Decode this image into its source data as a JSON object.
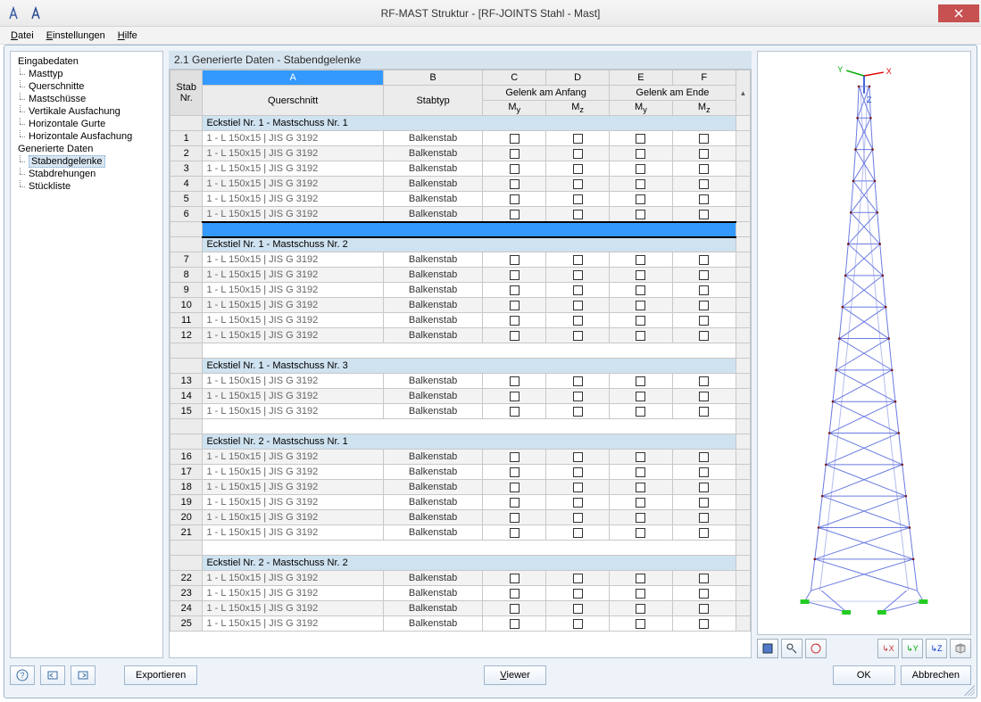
{
  "title": "RF-MAST Struktur - [RF-JOINTS Stahl - Mast]",
  "menu": {
    "file": "Datei",
    "settings": "Einstellungen",
    "help": "Hilfe"
  },
  "tree": {
    "g1": "Eingabedaten",
    "g1_items": [
      "Masttyp",
      "Querschnitte",
      "Mastschüsse",
      "Vertikale Ausfachung",
      "Horizontale Gurte",
      "Horizontale Ausfachung"
    ],
    "g2": "Generierte Daten",
    "g2_items": [
      "Stabendgelenke",
      "Stabdrehungen",
      "Stückliste"
    ],
    "selected": "Stabendgelenke"
  },
  "panel": {
    "title": "2.1 Generierte Daten - Stabendgelenke",
    "col_letters": [
      "A",
      "B",
      "C",
      "D",
      "E",
      "F"
    ],
    "col_stabnr_top": "Stab",
    "col_stabnr_bot": "Nr.",
    "col_quer": "Querschnitt",
    "col_stabtyp": "Stabtyp",
    "col_ganfang": "Gelenk am Anfang",
    "col_gende": "Gelenk am Ende",
    "col_my": "Mᵧ",
    "col_mz": "M_z"
  },
  "row_template": {
    "quer": "1 - L 150x15 | JIS G 3192",
    "typ": "Balkenstab"
  },
  "groups": [
    {
      "title": "Eckstiel Nr. 1  -  Mastschuss Nr. 1",
      "rows": [
        1,
        2,
        3,
        4,
        5,
        6
      ],
      "blue_after": true
    },
    {
      "title": "Eckstiel Nr. 1  -  Mastschuss Nr. 2",
      "rows": [
        7,
        8,
        9,
        10,
        11,
        12
      ]
    },
    {
      "title": "Eckstiel Nr. 1  -  Mastschuss Nr. 3",
      "rows": [
        13,
        14,
        15
      ]
    },
    {
      "title": "Eckstiel Nr. 2  -  Mastschuss Nr. 1",
      "rows": [
        16,
        17,
        18,
        19,
        20,
        21
      ]
    },
    {
      "title": "Eckstiel Nr. 2  -  Mastschuss Nr. 2",
      "rows": [
        22,
        23,
        24,
        25
      ]
    }
  ],
  "buttons": {
    "export": "Exportieren",
    "viewer": "Viewer",
    "ok": "OK",
    "cancel": "Abbrechen"
  }
}
